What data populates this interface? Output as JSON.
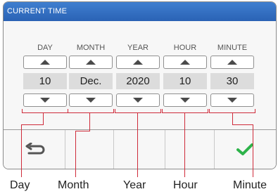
{
  "header": {
    "title": "CURRENT TIME"
  },
  "columns": [
    {
      "label": "DAY",
      "value": "10"
    },
    {
      "label": "MONTH",
      "value": "Dec."
    },
    {
      "label": "YEAR",
      "value": "2020"
    },
    {
      "label": "HOUR",
      "value": "10"
    },
    {
      "label": "MINUTE",
      "value": "30"
    }
  ],
  "footer": {
    "back_icon": "return-arrow",
    "confirm_icon": "checkmark",
    "confirm_color": "#2db34a"
  },
  "callouts": [
    "Day",
    "Month",
    "Year",
    "Hour",
    "Minute"
  ],
  "accent_color": "#cf2b3a"
}
